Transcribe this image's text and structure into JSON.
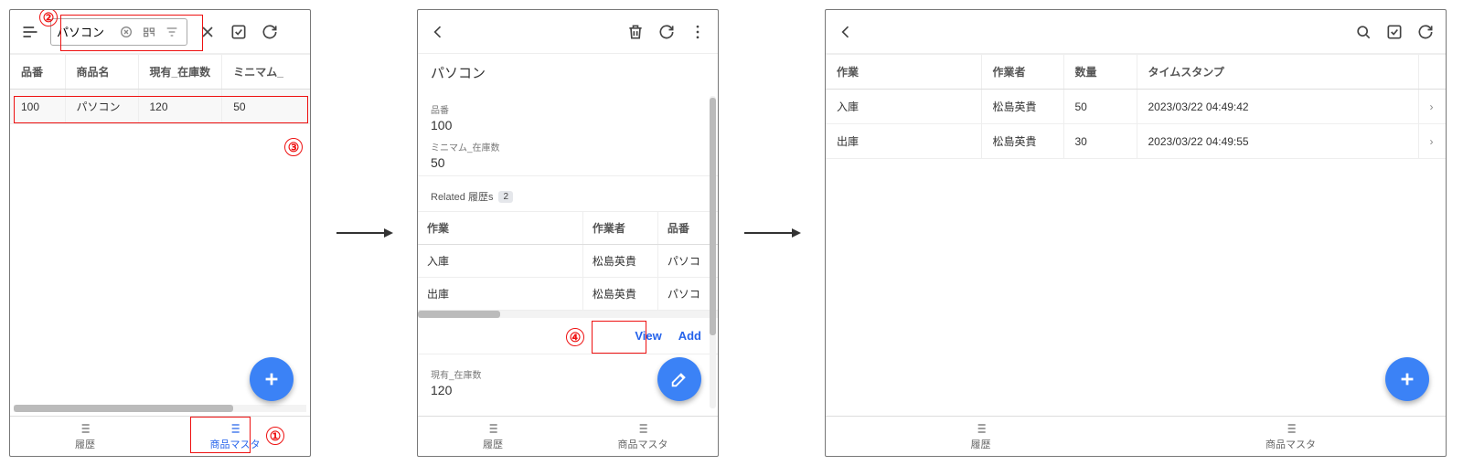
{
  "annotations": {
    "n1": "①",
    "n2": "②",
    "n3": "③",
    "n4": "④"
  },
  "panel1": {
    "search_value": "パソコン",
    "columns": [
      "品番",
      "商品名",
      "現有_在庫数",
      "ミニマム_"
    ],
    "row": {
      "c1": "100",
      "c2": "パソコン",
      "c3": "120",
      "c4": "50"
    },
    "tab_history": "履歴",
    "tab_master": "商品マスタ"
  },
  "panel2": {
    "title": "パソコン",
    "f1_label": "品番",
    "f1_val": "100",
    "f2_label": "ミニマム_在庫数",
    "f2_val": "50",
    "related_label": "Related 履歴s",
    "related_count": "2",
    "cols": [
      "作業",
      "作業者",
      "品番"
    ],
    "r1": {
      "c1": "入庫",
      "c2": "松島英貴",
      "c3": "パソコ"
    },
    "r2": {
      "c1": "出庫",
      "c2": "松島英貴",
      "c3": "パソコ"
    },
    "view": "View",
    "add": "Add",
    "f3_label": "現有_在庫数",
    "f3_val": "120",
    "tab_history": "履歴",
    "tab_master": "商品マスタ"
  },
  "panel3": {
    "cols": [
      "作業",
      "作業者",
      "数量",
      "タイムスタンプ",
      ""
    ],
    "r1": {
      "c1": "入庫",
      "c2": "松島英貴",
      "c3": "50",
      "c4": "2023/03/22 04:49:42"
    },
    "r2": {
      "c1": "出庫",
      "c2": "松島英貴",
      "c3": "30",
      "c4": "2023/03/22 04:49:55"
    },
    "tab_history": "履歴",
    "tab_master": "商品マスタ"
  }
}
